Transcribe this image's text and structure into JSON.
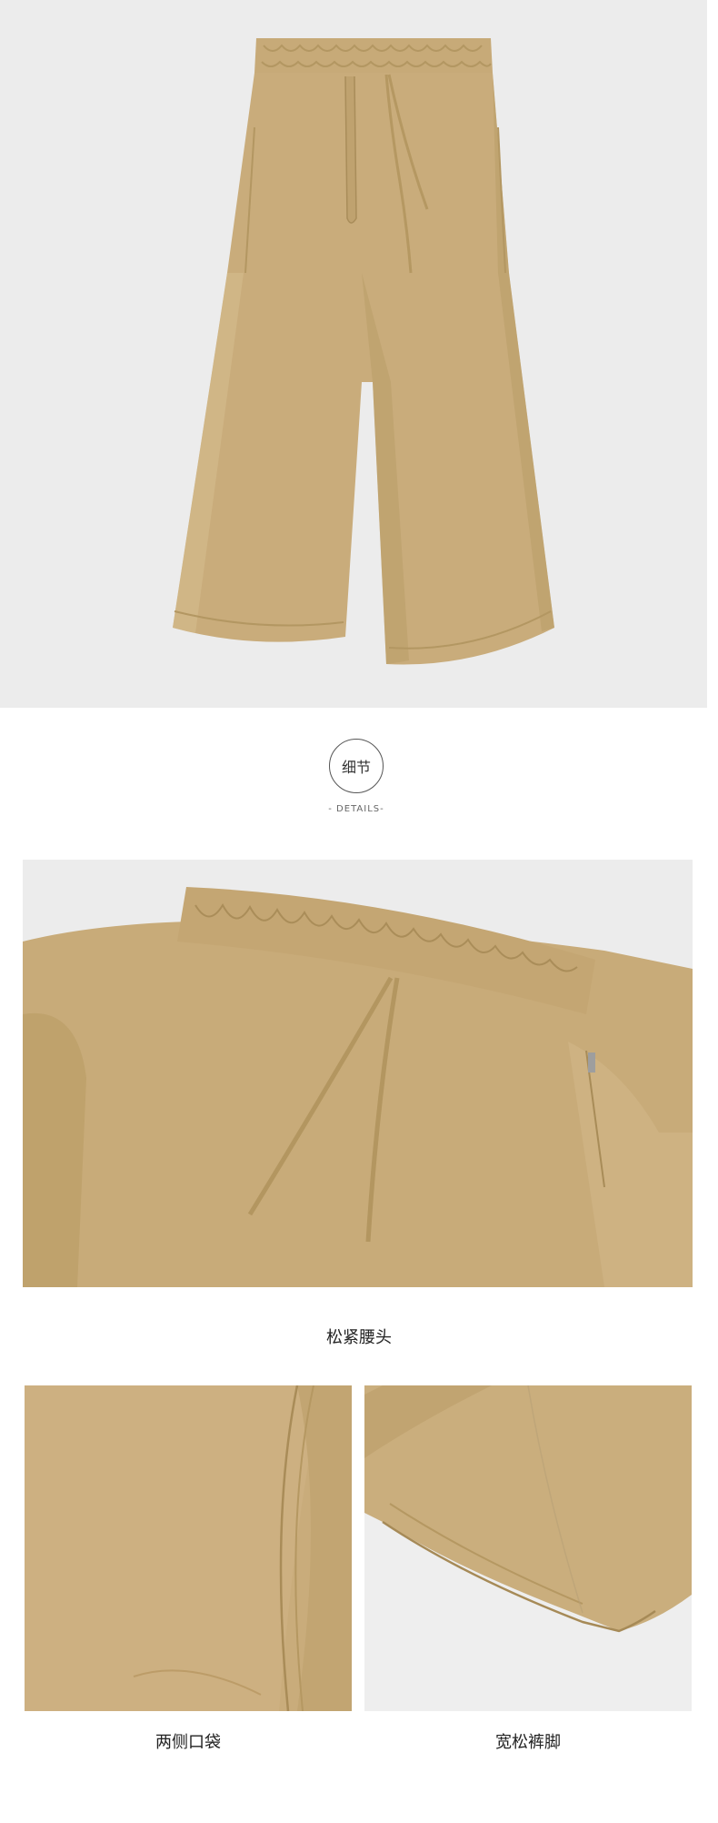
{
  "colors": {
    "fabric": "#c9ac7b",
    "fabric_dark": "#b2955f",
    "fabric_light": "#d8bf92",
    "background": "#ececec"
  },
  "section": {
    "title_cn": "细节",
    "title_en": "- DETAILS-"
  },
  "captions": {
    "waist": "松紧腰头",
    "pockets": "两侧口袋",
    "hem": "宽松裤脚"
  }
}
